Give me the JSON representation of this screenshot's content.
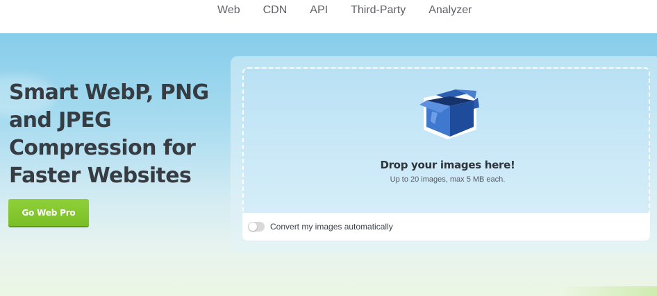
{
  "nav": {
    "items": [
      {
        "label": "Web"
      },
      {
        "label": "CDN"
      },
      {
        "label": "API"
      },
      {
        "label": "Third-Party"
      },
      {
        "label": "Analyzer"
      }
    ]
  },
  "hero": {
    "headline": {
      "lines": [
        "Smart WebP, PNG",
        "and JPEG",
        "Compression for",
        "Faster Websites"
      ]
    },
    "cta_label": "Go Web Pro"
  },
  "uploader": {
    "icon": "open-box-icon",
    "title": "Drop your images here!",
    "subtitle": "Up to 20 images, max 5 MB each.",
    "auto_convert": {
      "label": "Convert my images automatically",
      "enabled": false
    }
  },
  "colors": {
    "accent_green": "#7ec52a",
    "text_dark": "#373b42",
    "nav_text": "#5e6167",
    "box_blue": "#2f63b6"
  }
}
